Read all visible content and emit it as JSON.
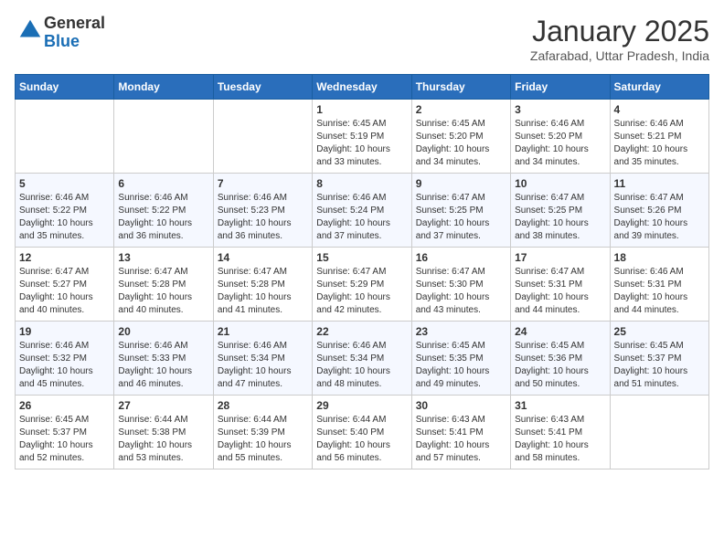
{
  "header": {
    "logo_line1": "General",
    "logo_line2": "Blue",
    "month": "January 2025",
    "location": "Zafarabad, Uttar Pradesh, India"
  },
  "days_of_week": [
    "Sunday",
    "Monday",
    "Tuesday",
    "Wednesday",
    "Thursday",
    "Friday",
    "Saturday"
  ],
  "weeks": [
    [
      {
        "day": "",
        "sunrise": "",
        "sunset": "",
        "daylight": ""
      },
      {
        "day": "",
        "sunrise": "",
        "sunset": "",
        "daylight": ""
      },
      {
        "day": "",
        "sunrise": "",
        "sunset": "",
        "daylight": ""
      },
      {
        "day": "1",
        "sunrise": "Sunrise: 6:45 AM",
        "sunset": "Sunset: 5:19 PM",
        "daylight": "Daylight: 10 hours and 33 minutes."
      },
      {
        "day": "2",
        "sunrise": "Sunrise: 6:45 AM",
        "sunset": "Sunset: 5:20 PM",
        "daylight": "Daylight: 10 hours and 34 minutes."
      },
      {
        "day": "3",
        "sunrise": "Sunrise: 6:46 AM",
        "sunset": "Sunset: 5:20 PM",
        "daylight": "Daylight: 10 hours and 34 minutes."
      },
      {
        "day": "4",
        "sunrise": "Sunrise: 6:46 AM",
        "sunset": "Sunset: 5:21 PM",
        "daylight": "Daylight: 10 hours and 35 minutes."
      }
    ],
    [
      {
        "day": "5",
        "sunrise": "Sunrise: 6:46 AM",
        "sunset": "Sunset: 5:22 PM",
        "daylight": "Daylight: 10 hours and 35 minutes."
      },
      {
        "day": "6",
        "sunrise": "Sunrise: 6:46 AM",
        "sunset": "Sunset: 5:22 PM",
        "daylight": "Daylight: 10 hours and 36 minutes."
      },
      {
        "day": "7",
        "sunrise": "Sunrise: 6:46 AM",
        "sunset": "Sunset: 5:23 PM",
        "daylight": "Daylight: 10 hours and 36 minutes."
      },
      {
        "day": "8",
        "sunrise": "Sunrise: 6:46 AM",
        "sunset": "Sunset: 5:24 PM",
        "daylight": "Daylight: 10 hours and 37 minutes."
      },
      {
        "day": "9",
        "sunrise": "Sunrise: 6:47 AM",
        "sunset": "Sunset: 5:25 PM",
        "daylight": "Daylight: 10 hours and 37 minutes."
      },
      {
        "day": "10",
        "sunrise": "Sunrise: 6:47 AM",
        "sunset": "Sunset: 5:25 PM",
        "daylight": "Daylight: 10 hours and 38 minutes."
      },
      {
        "day": "11",
        "sunrise": "Sunrise: 6:47 AM",
        "sunset": "Sunset: 5:26 PM",
        "daylight": "Daylight: 10 hours and 39 minutes."
      }
    ],
    [
      {
        "day": "12",
        "sunrise": "Sunrise: 6:47 AM",
        "sunset": "Sunset: 5:27 PM",
        "daylight": "Daylight: 10 hours and 40 minutes."
      },
      {
        "day": "13",
        "sunrise": "Sunrise: 6:47 AM",
        "sunset": "Sunset: 5:28 PM",
        "daylight": "Daylight: 10 hours and 40 minutes."
      },
      {
        "day": "14",
        "sunrise": "Sunrise: 6:47 AM",
        "sunset": "Sunset: 5:28 PM",
        "daylight": "Daylight: 10 hours and 41 minutes."
      },
      {
        "day": "15",
        "sunrise": "Sunrise: 6:47 AM",
        "sunset": "Sunset: 5:29 PM",
        "daylight": "Daylight: 10 hours and 42 minutes."
      },
      {
        "day": "16",
        "sunrise": "Sunrise: 6:47 AM",
        "sunset": "Sunset: 5:30 PM",
        "daylight": "Daylight: 10 hours and 43 minutes."
      },
      {
        "day": "17",
        "sunrise": "Sunrise: 6:47 AM",
        "sunset": "Sunset: 5:31 PM",
        "daylight": "Daylight: 10 hours and 44 minutes."
      },
      {
        "day": "18",
        "sunrise": "Sunrise: 6:46 AM",
        "sunset": "Sunset: 5:31 PM",
        "daylight": "Daylight: 10 hours and 44 minutes."
      }
    ],
    [
      {
        "day": "19",
        "sunrise": "Sunrise: 6:46 AM",
        "sunset": "Sunset: 5:32 PM",
        "daylight": "Daylight: 10 hours and 45 minutes."
      },
      {
        "day": "20",
        "sunrise": "Sunrise: 6:46 AM",
        "sunset": "Sunset: 5:33 PM",
        "daylight": "Daylight: 10 hours and 46 minutes."
      },
      {
        "day": "21",
        "sunrise": "Sunrise: 6:46 AM",
        "sunset": "Sunset: 5:34 PM",
        "daylight": "Daylight: 10 hours and 47 minutes."
      },
      {
        "day": "22",
        "sunrise": "Sunrise: 6:46 AM",
        "sunset": "Sunset: 5:34 PM",
        "daylight": "Daylight: 10 hours and 48 minutes."
      },
      {
        "day": "23",
        "sunrise": "Sunrise: 6:45 AM",
        "sunset": "Sunset: 5:35 PM",
        "daylight": "Daylight: 10 hours and 49 minutes."
      },
      {
        "day": "24",
        "sunrise": "Sunrise: 6:45 AM",
        "sunset": "Sunset: 5:36 PM",
        "daylight": "Daylight: 10 hours and 50 minutes."
      },
      {
        "day": "25",
        "sunrise": "Sunrise: 6:45 AM",
        "sunset": "Sunset: 5:37 PM",
        "daylight": "Daylight: 10 hours and 51 minutes."
      }
    ],
    [
      {
        "day": "26",
        "sunrise": "Sunrise: 6:45 AM",
        "sunset": "Sunset: 5:37 PM",
        "daylight": "Daylight: 10 hours and 52 minutes."
      },
      {
        "day": "27",
        "sunrise": "Sunrise: 6:44 AM",
        "sunset": "Sunset: 5:38 PM",
        "daylight": "Daylight: 10 hours and 53 minutes."
      },
      {
        "day": "28",
        "sunrise": "Sunrise: 6:44 AM",
        "sunset": "Sunset: 5:39 PM",
        "daylight": "Daylight: 10 hours and 55 minutes."
      },
      {
        "day": "29",
        "sunrise": "Sunrise: 6:44 AM",
        "sunset": "Sunset: 5:40 PM",
        "daylight": "Daylight: 10 hours and 56 minutes."
      },
      {
        "day": "30",
        "sunrise": "Sunrise: 6:43 AM",
        "sunset": "Sunset: 5:41 PM",
        "daylight": "Daylight: 10 hours and 57 minutes."
      },
      {
        "day": "31",
        "sunrise": "Sunrise: 6:43 AM",
        "sunset": "Sunset: 5:41 PM",
        "daylight": "Daylight: 10 hours and 58 minutes."
      },
      {
        "day": "",
        "sunrise": "",
        "sunset": "",
        "daylight": ""
      }
    ]
  ]
}
